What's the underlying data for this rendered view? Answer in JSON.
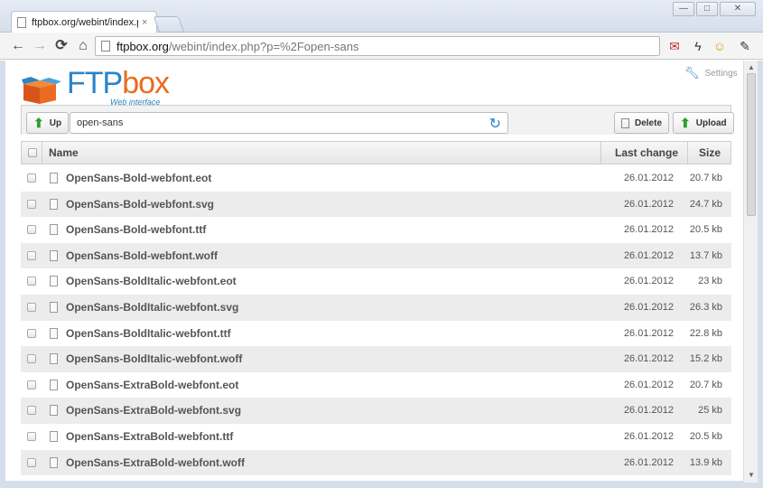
{
  "browser": {
    "tab_title": "ftpbox.org/webint/index.p",
    "tab_close": "×",
    "url_host": "ftpbox.org",
    "url_path": "/webint/index.php?p=%2Fopen-sans",
    "window_buttons": {
      "minimize": "—",
      "maximize": "□",
      "close": "✕"
    }
  },
  "app": {
    "logo": {
      "ftp": "FTP",
      "box": "box",
      "subtitle": "Web interface"
    },
    "settings_label": "Settings",
    "toolbar": {
      "up_label": "Up",
      "path_value": "open-sans",
      "delete_label": "Delete",
      "upload_label": "Upload"
    },
    "table": {
      "headers": {
        "name": "Name",
        "last_change": "Last change",
        "size": "Size"
      },
      "rows": [
        {
          "name": "OpenSans-Bold-webfont.eot",
          "date": "26.01.2012",
          "size": "20.7 kb"
        },
        {
          "name": "OpenSans-Bold-webfont.svg",
          "date": "26.01.2012",
          "size": "24.7 kb"
        },
        {
          "name": "OpenSans-Bold-webfont.ttf",
          "date": "26.01.2012",
          "size": "20.5 kb"
        },
        {
          "name": "OpenSans-Bold-webfont.woff",
          "date": "26.01.2012",
          "size": "13.7 kb"
        },
        {
          "name": "OpenSans-BoldItalic-webfont.eot",
          "date": "26.01.2012",
          "size": "23 kb"
        },
        {
          "name": "OpenSans-BoldItalic-webfont.svg",
          "date": "26.01.2012",
          "size": "26.3 kb"
        },
        {
          "name": "OpenSans-BoldItalic-webfont.ttf",
          "date": "26.01.2012",
          "size": "22.8 kb"
        },
        {
          "name": "OpenSans-BoldItalic-webfont.woff",
          "date": "26.01.2012",
          "size": "15.2 kb"
        },
        {
          "name": "OpenSans-ExtraBold-webfont.eot",
          "date": "26.01.2012",
          "size": "20.7 kb"
        },
        {
          "name": "OpenSans-ExtraBold-webfont.svg",
          "date": "26.01.2012",
          "size": "25 kb"
        },
        {
          "name": "OpenSans-ExtraBold-webfont.ttf",
          "date": "26.01.2012",
          "size": "20.5 kb"
        },
        {
          "name": "OpenSans-ExtraBold-webfont.woff",
          "date": "26.01.2012",
          "size": "13.9 kb"
        }
      ]
    }
  },
  "colors": {
    "brand_blue": "#2a84c7",
    "brand_orange": "#ea6b21",
    "upload_green": "#2aa12a"
  }
}
